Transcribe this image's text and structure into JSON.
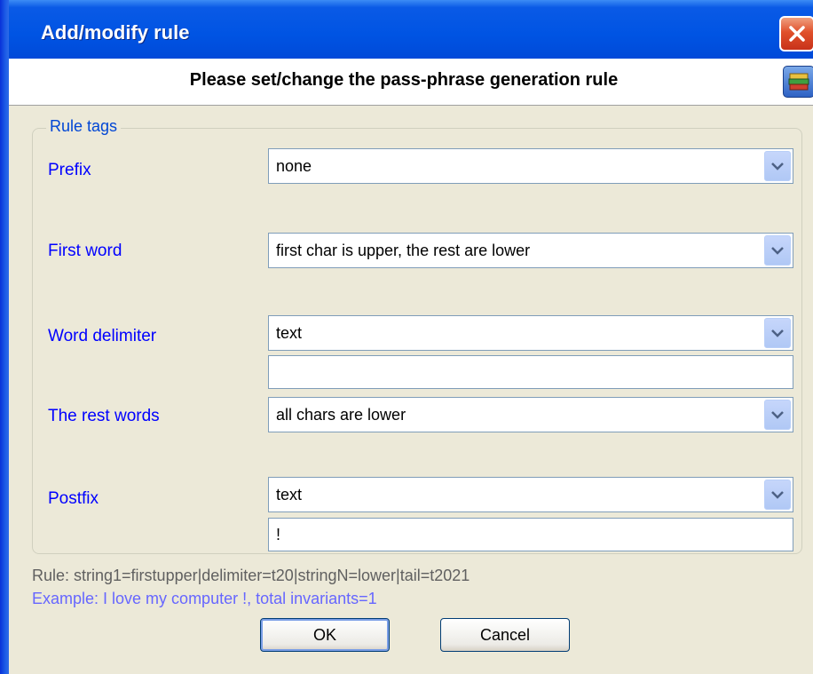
{
  "window": {
    "title": "Add/modify rule",
    "header": "Please set/change the pass-phrase generation rule"
  },
  "group": {
    "legend": "Rule tags"
  },
  "fields": {
    "prefix": {
      "label": "Prefix",
      "value": "none"
    },
    "first_word": {
      "label": "First word",
      "value": "first char is upper, the rest are lower"
    },
    "word_delimiter": {
      "label": "Word delimiter",
      "value": "text",
      "text": ""
    },
    "rest_words": {
      "label": "The rest words",
      "value": "all chars are lower"
    },
    "postfix": {
      "label": "Postfix",
      "value": "text",
      "text": "!"
    }
  },
  "rule_text": "Rule: string1=firstupper|delimiter=t20|stringN=lower|tail=t2021",
  "example_text": "Example: I love my computer !,  total invariants=1",
  "buttons": {
    "ok": "OK",
    "cancel": "Cancel"
  },
  "colors": {
    "label_blue": "#0000ff",
    "example_blue": "#6666ff",
    "titlebar_blue": "#0054e3",
    "close_red": "#e0502a"
  },
  "icons": {
    "close": "close-icon",
    "help": "help-book-icon",
    "dropdown": "chevron-down-icon"
  }
}
